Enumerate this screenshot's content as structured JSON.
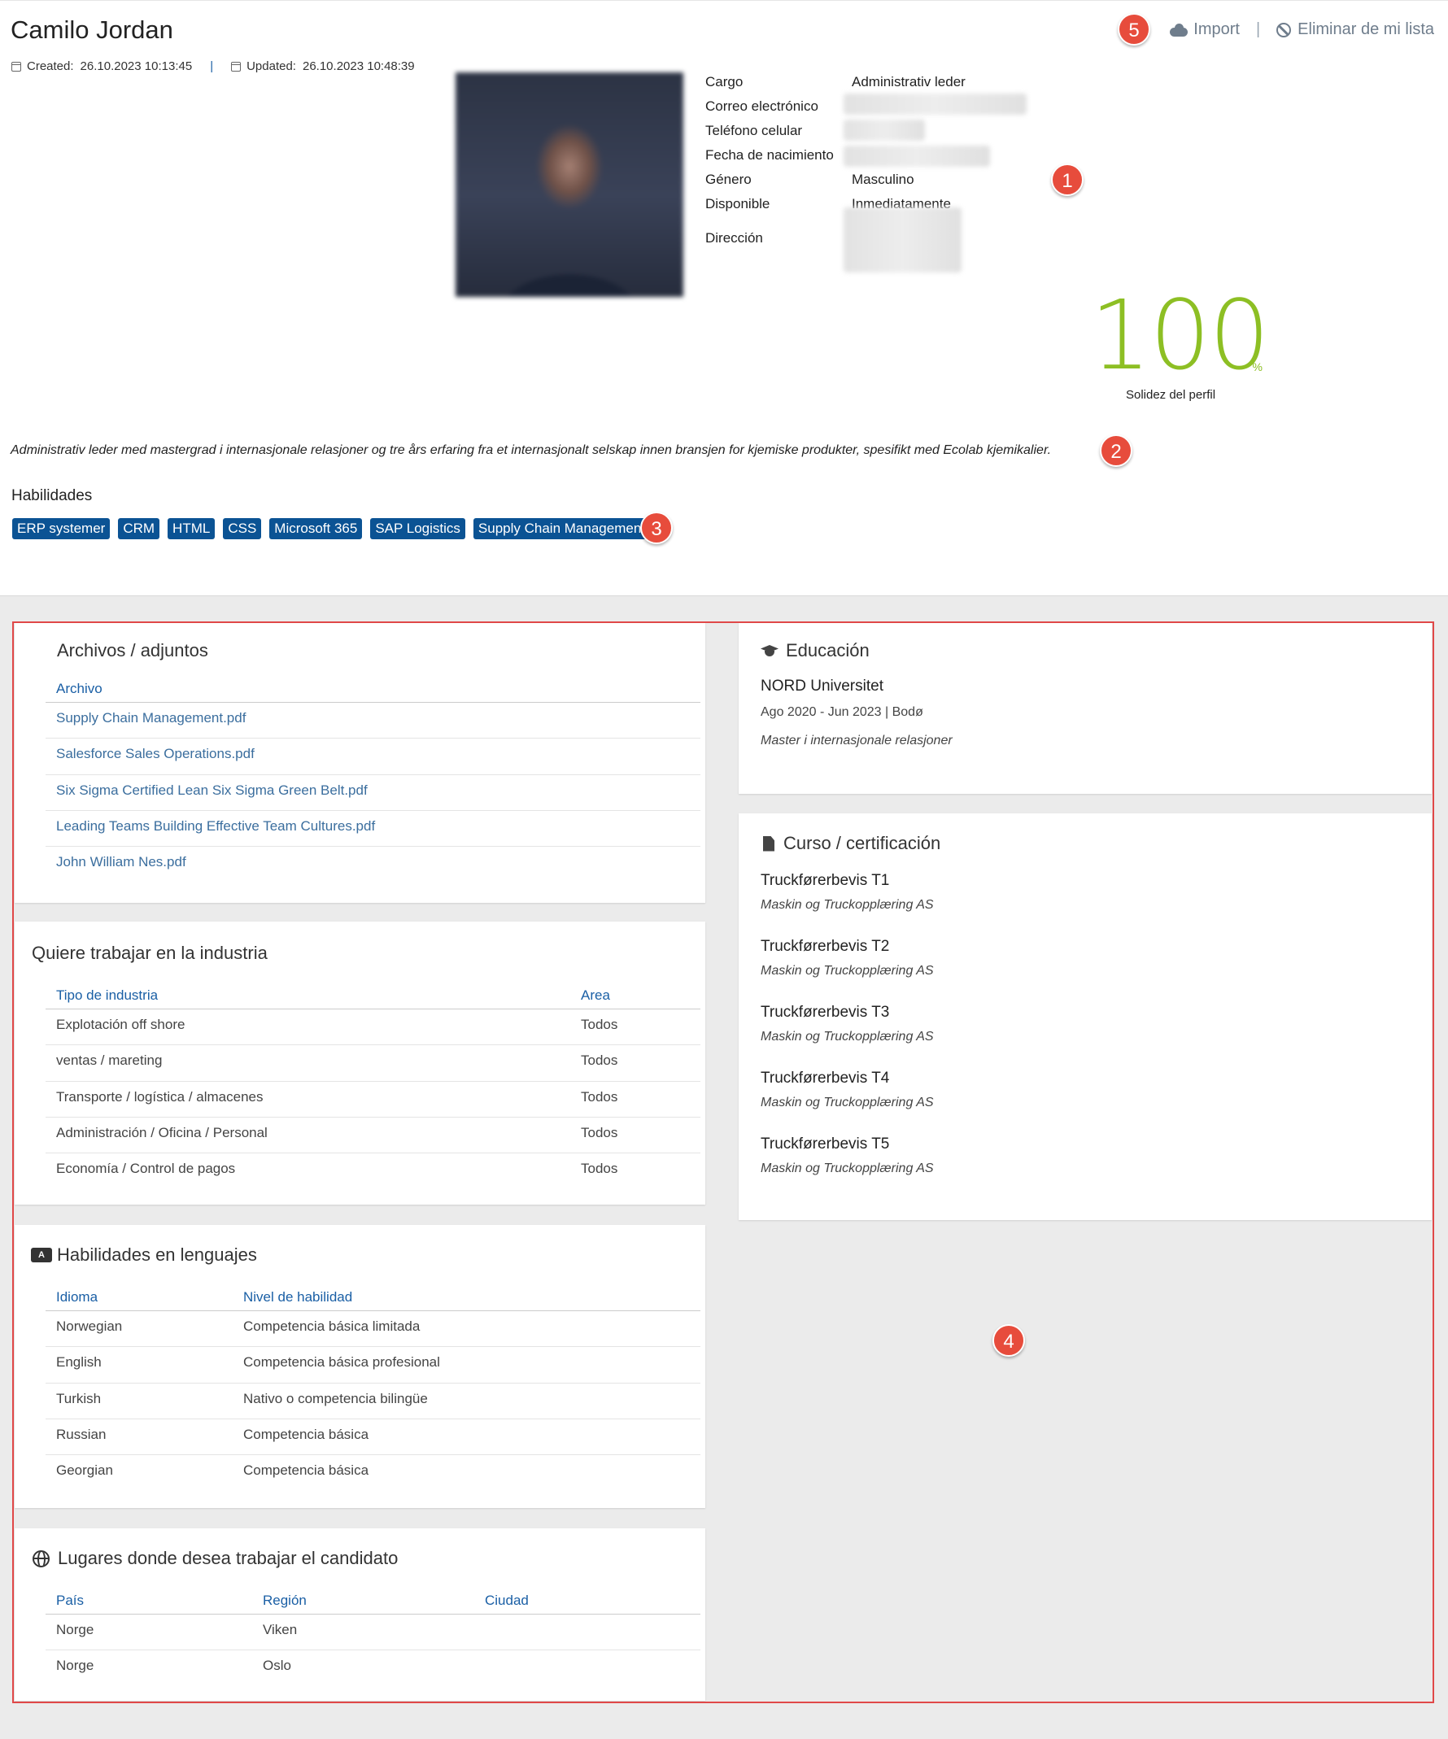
{
  "profile": {
    "name": "Camilo Jordan",
    "created_label": "Created:",
    "created": "26.10.2023 10:13:45",
    "updated_label": "Updated:",
    "updated": "26.10.2023 10:48:39",
    "meta_sep": "|"
  },
  "actions": {
    "import": "Import",
    "sep": "|",
    "remove": "Eliminar de mi lista"
  },
  "details": {
    "cargo_label": "Cargo",
    "cargo": "Administrativ leder",
    "email_label": "Correo electrónico",
    "phone_label": "Teléfono celular",
    "birth_label": "Fecha de nacimiento",
    "gender_label": "Género",
    "gender": "Masculino",
    "available_label": "Disponible",
    "available": "Inmediatamente",
    "address_label": "Dirección"
  },
  "score": {
    "value": "100",
    "unit": "%",
    "label": "Solidez del perfil"
  },
  "summary": "Administrativ leder med mastergrad i internasjonale relasjoner og tre års erfaring fra et internasjonalt selskap innen bransjen for kjemiske produkter, spesifikt med Ecolab kjemikalier.",
  "skills": {
    "title": "Habilidades",
    "items": [
      "ERP systemer",
      "CRM",
      "HTML",
      "CSS",
      "Microsoft 365",
      "SAP Logistics",
      "Supply Chain Management"
    ]
  },
  "badges": [
    "1",
    "2",
    "3",
    "4",
    "5"
  ],
  "files": {
    "title": "Archivos / adjuntos",
    "header": "Archivo",
    "items": [
      "Supply Chain Management.pdf",
      "Salesforce Sales Operations.pdf",
      "Six Sigma Certified Lean Six Sigma Green Belt.pdf",
      "Leading Teams Building Effective Team Cultures.pdf",
      "John William Nes.pdf"
    ]
  },
  "industry": {
    "title": "Quiere trabajar en la industria",
    "headers": [
      "Tipo de industria",
      "Area"
    ],
    "rows": [
      [
        "Explotación off shore",
        "Todos"
      ],
      [
        "ventas / mareting",
        "Todos"
      ],
      [
        "Transporte / logística / almacenes",
        "Todos"
      ],
      [
        "Administración / Oficina / Personal",
        "Todos"
      ],
      [
        "Economía / Control de pagos",
        "Todos"
      ]
    ]
  },
  "languages": {
    "title": "Habilidades en lenguajes",
    "headers": [
      "Idioma",
      "Nivel de habilidad"
    ],
    "rows": [
      [
        "Norwegian",
        "Competencia básica limitada"
      ],
      [
        "English",
        "Competencia básica profesional"
      ],
      [
        "Turkish",
        "Nativo o competencia bilingüe"
      ],
      [
        "Russian",
        "Competencia básica"
      ],
      [
        "Georgian",
        "Competencia básica"
      ]
    ]
  },
  "places": {
    "title": "Lugares donde desea trabajar el candidato",
    "headers": [
      "País",
      "Región",
      "Ciudad"
    ],
    "rows": [
      [
        "Norge",
        "Viken",
        ""
      ],
      [
        "Norge",
        "Oslo",
        ""
      ]
    ]
  },
  "education": {
    "title": "Educación",
    "school": "NORD Universitet",
    "period": "Ago 2020 - Jun 2023 | Bodø",
    "degree": "Master i internasjonale relasjoner"
  },
  "courses": {
    "title": "Curso / certificación",
    "items": [
      {
        "name": "Truckførerbevis T1",
        "provider": "Maskin og Truckopplæring AS"
      },
      {
        "name": "Truckførerbevis T2",
        "provider": "Maskin og Truckopplæring AS"
      },
      {
        "name": "Truckførerbevis T3",
        "provider": "Maskin og Truckopplæring AS"
      },
      {
        "name": "Truckførerbevis T4",
        "provider": "Maskin og Truckopplæring AS"
      },
      {
        "name": "Truckførerbevis T5",
        "provider": "Maskin og Truckopplæring AS"
      }
    ]
  }
}
